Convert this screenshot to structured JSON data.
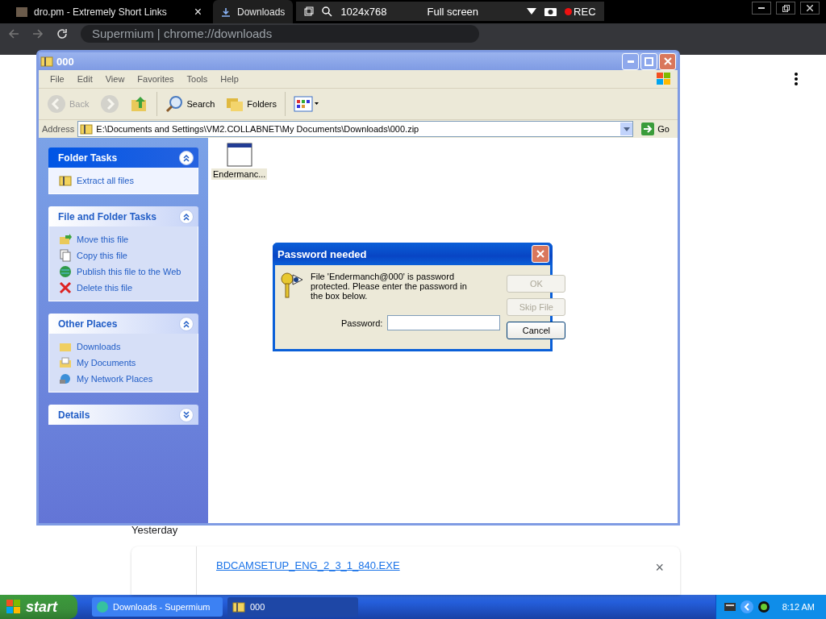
{
  "browser": {
    "tabs": [
      {
        "label": "dro.pm - Extremely Short Links",
        "selected": false,
        "close": "×"
      },
      {
        "label": "Downloads",
        "selected": true
      }
    ],
    "recorder": {
      "resolution": "1024x768",
      "mode": "Full screen",
      "rec": "REC"
    },
    "address": "Supermium | chrome://downloads"
  },
  "page": {
    "date": "Yesterday",
    "download": {
      "name": "BDCAMSETUP_ENG_2_3_1_840.EXE",
      "close": "×"
    }
  },
  "explorer": {
    "title": "000",
    "menu": [
      "File",
      "Edit",
      "View",
      "Favorites",
      "Tools",
      "Help"
    ],
    "toolbar": [
      {
        "kind": "back",
        "label": "Back",
        "disabled": true
      },
      {
        "kind": "forward",
        "disabled": true
      },
      {
        "kind": "up",
        "disabled": false
      },
      {
        "kind": "search",
        "label": "Search",
        "disabled": false
      },
      {
        "kind": "folders",
        "label": "Folders",
        "disabled": false
      },
      {
        "kind": "views",
        "disabled": false
      }
    ],
    "address_label": "Address",
    "address": "E:\\Documents and Settings\\VM2.COLLABNET\\My Documents\\Downloads\\000.zip",
    "go": "Go",
    "panels": [
      {
        "title": "Folder Tasks",
        "kind": "special",
        "expanded": true,
        "items": [
          {
            "label": "Extract all files",
            "kind": "extract"
          }
        ]
      },
      {
        "title": "File and Folder Tasks",
        "kind": "normal",
        "expanded": true,
        "items": [
          {
            "label": "Move this file",
            "kind": "move"
          },
          {
            "label": "Copy this file",
            "kind": "copy"
          },
          {
            "label": "Publish this file to the Web",
            "kind": "web"
          },
          {
            "label": "Delete this file",
            "kind": "delete"
          }
        ]
      },
      {
        "title": "Other Places",
        "kind": "normal",
        "expanded": true,
        "items": [
          {
            "label": "Downloads",
            "kind": "folder"
          },
          {
            "label": "My Documents",
            "kind": "docs"
          },
          {
            "label": "My Network Places",
            "kind": "network"
          }
        ]
      },
      {
        "title": "Details",
        "kind": "normal",
        "expanded": false
      }
    ],
    "files": [
      {
        "label": "Endermanc...",
        "selected": true
      }
    ]
  },
  "dialog": {
    "title": "Password needed",
    "message": "File 'Endermanch@000' is password protected.  Please enter the password in the box below.",
    "password_label": "Password:",
    "buttons": [
      {
        "label": "OK",
        "disabled": true
      },
      {
        "label": "Skip File",
        "disabled": true
      },
      {
        "label": "Cancel",
        "disabled": false
      }
    ]
  },
  "taskbar": {
    "start": "start",
    "tasks": [
      {
        "label": "Downloads - Supermium",
        "selected": false
      },
      {
        "label": "000",
        "selected": true
      }
    ],
    "time": "8:12 AM"
  }
}
